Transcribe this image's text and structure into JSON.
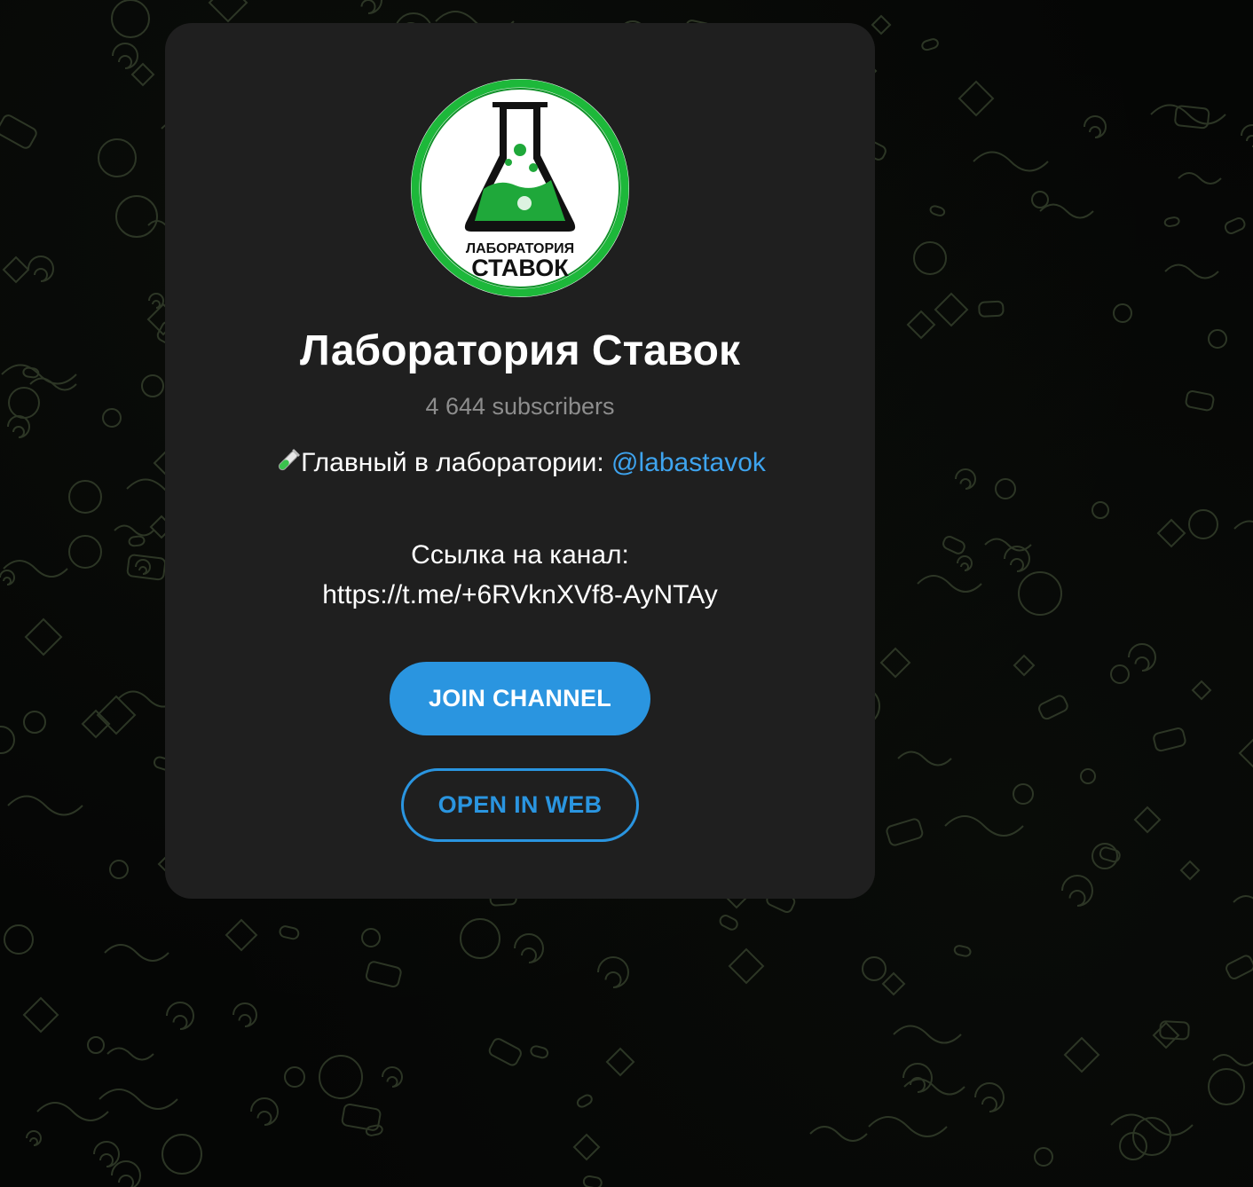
{
  "channel": {
    "title": "Лаборатория Ставок",
    "subscribers": "4 644 subscribers",
    "description": {
      "lead_icon": "test-tube-icon",
      "lead_text": "Главный в лаборатории: ",
      "mention": "@labastavok",
      "link_label": "Ссылка на канал:",
      "link_url": "https://t.me/+6RVknXVf8-AyNTAy"
    },
    "avatar": {
      "logo_line1": "ЛАБОРАТОРИЯ",
      "logo_line2": "СТАВОК"
    }
  },
  "actions": {
    "join_label": "JOIN CHANNEL",
    "open_web_label": "OPEN IN WEB"
  },
  "colors": {
    "accent": "#2a95e0",
    "mention": "#3ea4ef",
    "card_bg": "#1f1f1f",
    "logo_green": "#1db83a"
  }
}
